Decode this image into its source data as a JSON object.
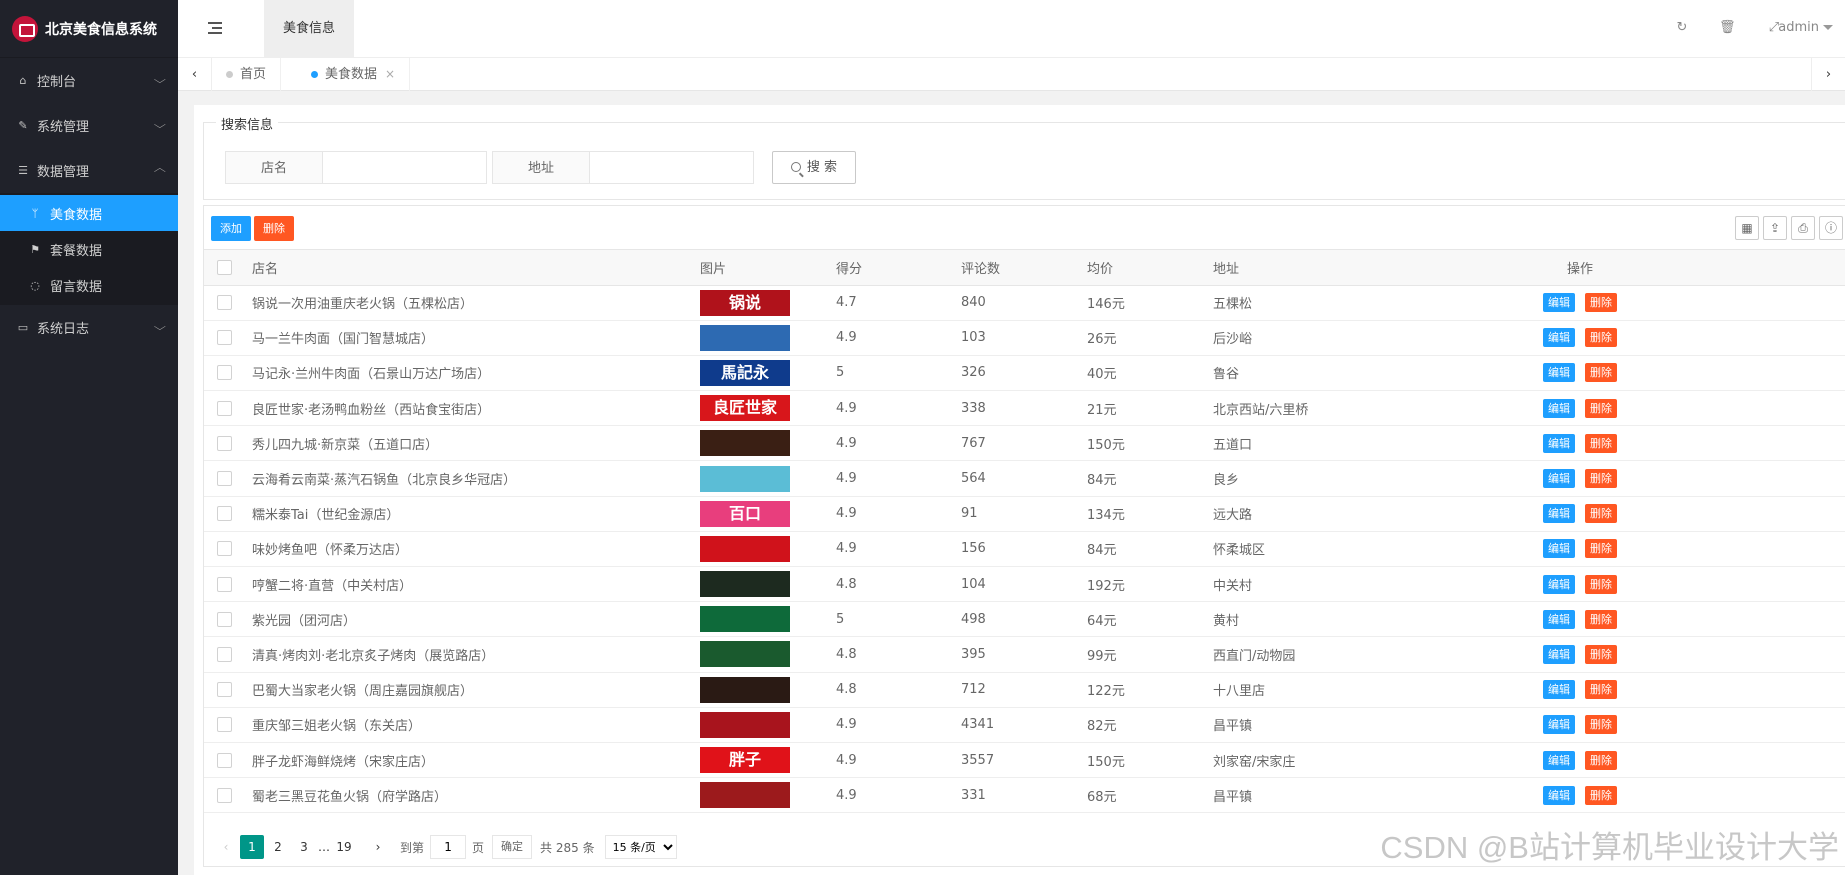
{
  "app": {
    "title": "北京美食信息系统"
  },
  "sidebar": {
    "items": [
      {
        "label": "控制台",
        "icon": "home-icon"
      },
      {
        "label": "系统管理",
        "icon": "wrench-icon"
      },
      {
        "label": "数据管理",
        "icon": "database-icon"
      },
      {
        "label": "系统日志",
        "icon": "laptop-icon"
      }
    ],
    "subitems": [
      {
        "label": "美食数据",
        "icon": "food-icon",
        "active": true
      },
      {
        "label": "套餐数据",
        "icon": "flag-icon"
      },
      {
        "label": "留言数据",
        "icon": "message-icon"
      }
    ]
  },
  "header": {
    "active_tab": "美食信息",
    "user": "admin"
  },
  "tabs": [
    {
      "label": "首页"
    },
    {
      "label": "美食数据",
      "active": true
    }
  ],
  "search": {
    "legend": "搜索信息",
    "name_label": "店名",
    "address_label": "地址",
    "name_value": "",
    "address_value": "",
    "button": "搜 索"
  },
  "toolbar": {
    "add": "添加",
    "delete": "删除"
  },
  "table": {
    "columns": [
      "店名",
      "图片",
      "得分",
      "评论数",
      "均价",
      "地址",
      "操作"
    ],
    "edit_label": "编辑",
    "delete_label": "删除",
    "rows": [
      {
        "name": "锅说一次用油重庆老火锅（五棵松店）",
        "score": "4.7",
        "comments": "840",
        "price": "146元",
        "address": "五棵松",
        "img_color": "#b0121b",
        "img_text": "锅说"
      },
      {
        "name": "马一兰牛肉面（国门智慧城店）",
        "score": "4.9",
        "comments": "103",
        "price": "26元",
        "address": "后沙峪",
        "img_color": "#2d6ab2",
        "img_text": ""
      },
      {
        "name": "马记永·兰州牛肉面（石景山万达广场店）",
        "score": "5",
        "comments": "326",
        "price": "40元",
        "address": "鲁谷",
        "img_color": "#0f3b8c",
        "img_text": "馬記永"
      },
      {
        "name": "良匠世家·老汤鸭血粉丝（西站食宝街店）",
        "score": "4.9",
        "comments": "338",
        "price": "21元",
        "address": "北京西站/六里桥",
        "img_color": "#d8161b",
        "img_text": "良匠世家"
      },
      {
        "name": "秀儿四九城·新京菜（五道口店）",
        "score": "4.9",
        "comments": "767",
        "price": "150元",
        "address": "五道口",
        "img_color": "#3a1f14",
        "img_text": ""
      },
      {
        "name": "云海肴云南菜·蒸汽石锅鱼（北京良乡华冠店）",
        "score": "4.9",
        "comments": "564",
        "price": "84元",
        "address": "良乡",
        "img_color": "#5bbdd6",
        "img_text": ""
      },
      {
        "name": "糯米泰Tai（世纪金源店）",
        "score": "4.9",
        "comments": "91",
        "price": "134元",
        "address": "远大路",
        "img_color": "#e83e7d",
        "img_text": "百口"
      },
      {
        "name": "味妙烤鱼吧（怀柔万达店）",
        "score": "4.9",
        "comments": "156",
        "price": "84元",
        "address": "怀柔城区",
        "img_color": "#d0121b",
        "img_text": ""
      },
      {
        "name": "哼蟹二将·直营（中关村店）",
        "score": "4.8",
        "comments": "104",
        "price": "192元",
        "address": "中关村",
        "img_color": "#1d2a1f",
        "img_text": ""
      },
      {
        "name": "紫光园（团河店）",
        "score": "5",
        "comments": "498",
        "price": "64元",
        "address": "黄村",
        "img_color": "#0e6a3a",
        "img_text": ""
      },
      {
        "name": "清真·烤肉刘·老北京炙子烤肉（展览路店）",
        "score": "4.8",
        "comments": "395",
        "price": "99元",
        "address": "西直门/动物园",
        "img_color": "#1a5a2e",
        "img_text": ""
      },
      {
        "name": "巴蜀大当家老火锅（周庄嘉园旗舰店）",
        "score": "4.8",
        "comments": "712",
        "price": "122元",
        "address": "十八里店",
        "img_color": "#2a1a14",
        "img_text": ""
      },
      {
        "name": "重庆邹三姐老火锅（东关店）",
        "score": "4.9",
        "comments": "4341",
        "price": "82元",
        "address": "昌平镇",
        "img_color": "#a8141d",
        "img_text": ""
      },
      {
        "name": "胖子龙虾海鲜烧烤（宋家庄店）",
        "score": "4.9",
        "comments": "3557",
        "price": "150元",
        "address": "刘家窑/宋家庄",
        "img_color": "#e01219",
        "img_text": "胖子"
      },
      {
        "name": "蜀老三黑豆花鱼火锅（府学路店）",
        "score": "4.9",
        "comments": "331",
        "price": "68元",
        "address": "昌平镇",
        "img_color": "#9c1a1c",
        "img_text": ""
      }
    ]
  },
  "pager": {
    "pages": [
      "1",
      "2",
      "3"
    ],
    "ellipsis": "…",
    "last": "19",
    "goto_label": "到第",
    "goto_value": "1",
    "page_unit": "页",
    "confirm": "确定",
    "total": "共 285 条",
    "page_size": "15 条/页"
  },
  "watermark": "CSDN @B站计算机毕业设计大学"
}
